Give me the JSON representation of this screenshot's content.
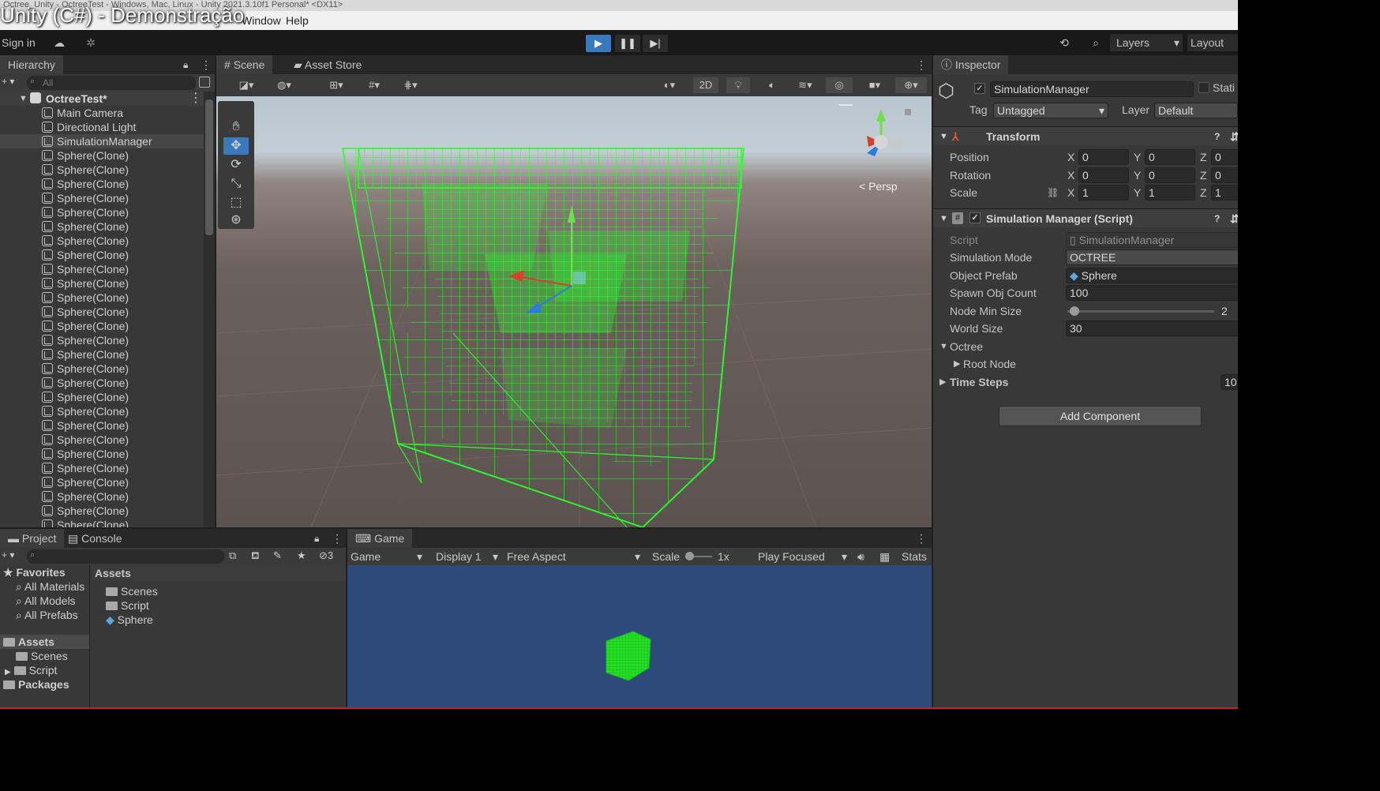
{
  "window": {
    "titlebar_text": "Octree_Unity - OctreeTest - Windows, Mac, Linux - Unity 2021.3.10f1 Personal* <DX11>",
    "overlay_title": "Unity (C#) - Demonstração"
  },
  "menu": {
    "window": "Window",
    "help": "Help"
  },
  "toolbar": {
    "sign_in": "Sign in",
    "layers": "Layers",
    "layout": "Layout"
  },
  "hierarchy": {
    "tab": "Hierarchy",
    "search_placeholder": "All",
    "scene_name": "OctreeTest*",
    "items": [
      "Main Camera",
      "Directional Light",
      "SimulationManager",
      "Sphere(Clone)",
      "Sphere(Clone)",
      "Sphere(Clone)",
      "Sphere(Clone)",
      "Sphere(Clone)",
      "Sphere(Clone)",
      "Sphere(Clone)",
      "Sphere(Clone)",
      "Sphere(Clone)",
      "Sphere(Clone)",
      "Sphere(Clone)",
      "Sphere(Clone)",
      "Sphere(Clone)",
      "Sphere(Clone)",
      "Sphere(Clone)",
      "Sphere(Clone)",
      "Sphere(Clone)",
      "Sphere(Clone)",
      "Sphere(Clone)",
      "Sphere(Clone)",
      "Sphere(Clone)",
      "Sphere(Clone)",
      "Sphere(Clone)",
      "Sphere(Clone)",
      "Sphere(Clone)",
      "Sphere(Clone)",
      "Sphere(Clone)",
      "Sphere(Clone)"
    ]
  },
  "scene": {
    "tab_scene": "Scene",
    "tab_asset_store": "Asset Store",
    "btn_2d": "2D",
    "persp_label": "Persp"
  },
  "inspector": {
    "tab": "Inspector",
    "object_name": "SimulationManager",
    "static_label": "Stati",
    "tag_label": "Tag",
    "tag_value": "Untagged",
    "layer_label": "Layer",
    "layer_value": "Default",
    "transform": {
      "title": "Transform",
      "position_label": "Position",
      "rotation_label": "Rotation",
      "scale_label": "Scale",
      "position": {
        "x": "0",
        "y": "0",
        "z": "0"
      },
      "rotation": {
        "x": "0",
        "y": "0",
        "z": "0"
      },
      "scale": {
        "x": "1",
        "y": "1",
        "z": "1"
      }
    },
    "script_component": {
      "title": "Simulation Manager (Script)",
      "script_label": "Script",
      "script_value": "SimulationManager",
      "mode_label": "Simulation Mode",
      "mode_value": "OCTREE",
      "prefab_label": "Object Prefab",
      "prefab_value": "Sphere",
      "spawn_label": "Spawn Obj Count",
      "spawn_value": "100",
      "nodemin_label": "Node Min Size",
      "nodemin_value": "2",
      "nodemin_fraction": 0.05,
      "world_label": "World Size",
      "world_value": "30",
      "octree_label": "Octree",
      "root_label": "Root Node",
      "timesteps_label": "Time Steps",
      "timesteps_value": "10"
    },
    "add_component": "Add Component"
  },
  "project": {
    "tab_project": "Project",
    "tab_console": "Console",
    "hidden_count": "3",
    "favorites": "Favorites",
    "fav_items": [
      "All Materials",
      "All Models",
      "All Prefabs"
    ],
    "assets_root": "Assets",
    "tree_items": [
      "Scenes",
      "Script"
    ],
    "packages": "Packages",
    "assets_header": "Assets",
    "asset_items": [
      "Scenes",
      "Script",
      "Sphere"
    ]
  },
  "game": {
    "tab": "Game",
    "mode": "Game",
    "display": "Display 1",
    "aspect": "Free Aspect",
    "scale_label": "Scale",
    "scale_value": "1x",
    "play_focused": "Play Focused",
    "stats": "Stats"
  },
  "colors": {
    "octree_green": "#2bff2b",
    "accent_blue": "#3a79bb",
    "game_bg": "#2e4a7a"
  }
}
